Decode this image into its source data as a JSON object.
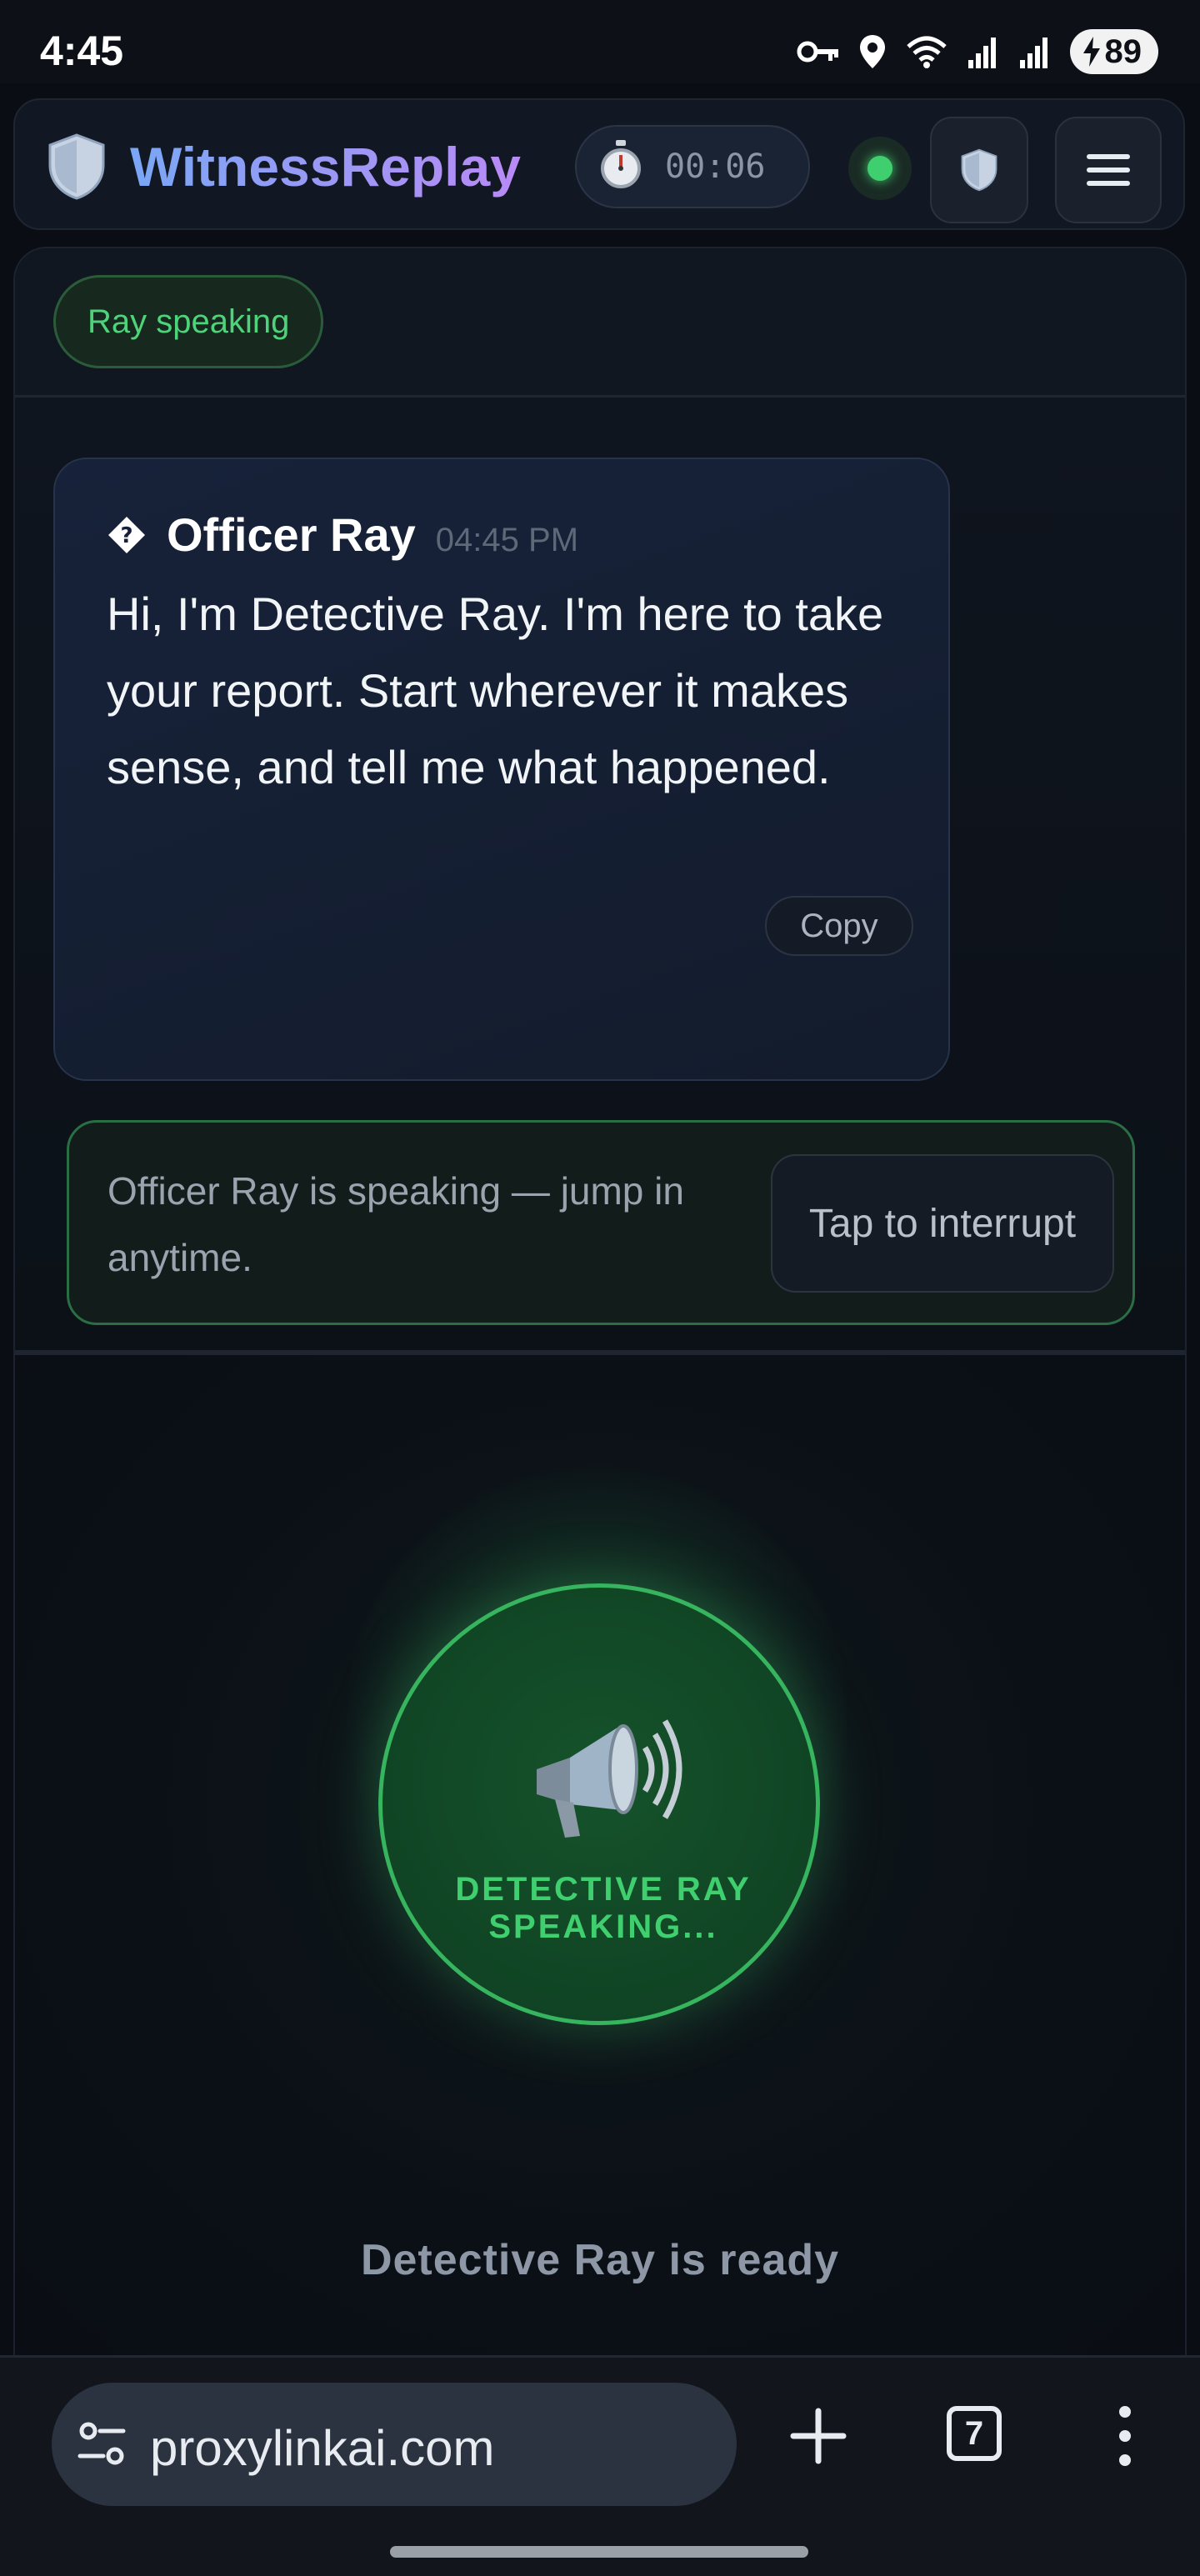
{
  "status_bar": {
    "time": "4:45",
    "battery": "89",
    "icons": [
      "vpn-key-icon",
      "location-icon",
      "wifi-icon",
      "signal-icon",
      "signal-icon",
      "charging-icon"
    ]
  },
  "header": {
    "app_title": "WitnessReplay",
    "timer": "00:06",
    "connection_color": "#3fcf6e",
    "title_gradient": [
      "#7aa7f5",
      "#b98af5"
    ]
  },
  "session": {
    "status_badge": "Ray speaking"
  },
  "message": {
    "sender": "Officer Ray",
    "time": "04:45 PM",
    "text": "Hi, I'm Detective Ray. I'm here to take your report. Start wherever it makes sense, and tell me what happened.",
    "copy_label": "Copy"
  },
  "interrupt": {
    "text": "Officer Ray is speaking — jump in anytime.",
    "button_label": "Tap to interrupt"
  },
  "voice": {
    "label": "DETECTIVE RAY SPEAKING...",
    "ready_text": "Detective Ray is ready",
    "accent_color": "#36b45e"
  },
  "browser": {
    "url": "proxylinkai.com",
    "tab_count": "7"
  }
}
